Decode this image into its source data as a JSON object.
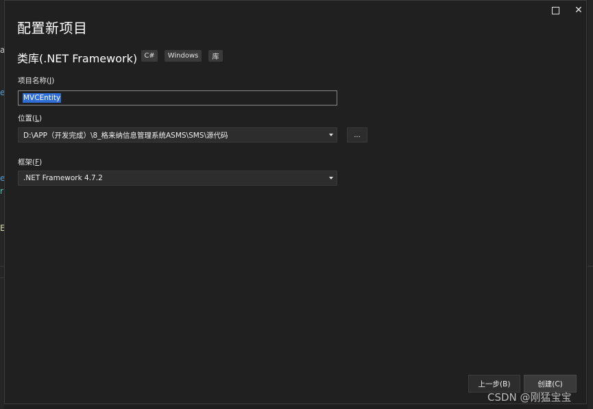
{
  "dialog": {
    "heading": "配置新项目",
    "template_name": "类库(.NET Framework)",
    "tags": [
      "C#",
      "Windows",
      "库"
    ]
  },
  "window_controls": {
    "maximize_label": "",
    "close_label": "✕"
  },
  "fields": {
    "project_name": {
      "label_prefix": "项目名称(",
      "label_key": "J",
      "label_suffix": ")",
      "value": "MVCEntity"
    },
    "location": {
      "label_prefix": "位置(",
      "label_key": "L",
      "label_suffix": ")",
      "value": "D:\\APP（开发完成）\\8_格来纳信息管理系统ASMS\\SMS\\源代码",
      "browse_label": "..."
    },
    "framework": {
      "label_prefix": "框架(",
      "label_key": "F",
      "label_suffix": ")",
      "value": ".NET Framework 4.7.2"
    }
  },
  "buttons": {
    "back": "上一步(B)",
    "create": "创建(C)"
  },
  "watermark": "CSDN @刚猛宝宝",
  "background_fragments": {
    "a1": "a",
    "a2": "e",
    "a3": "e",
    "a4": "r",
    "a5": "E"
  }
}
